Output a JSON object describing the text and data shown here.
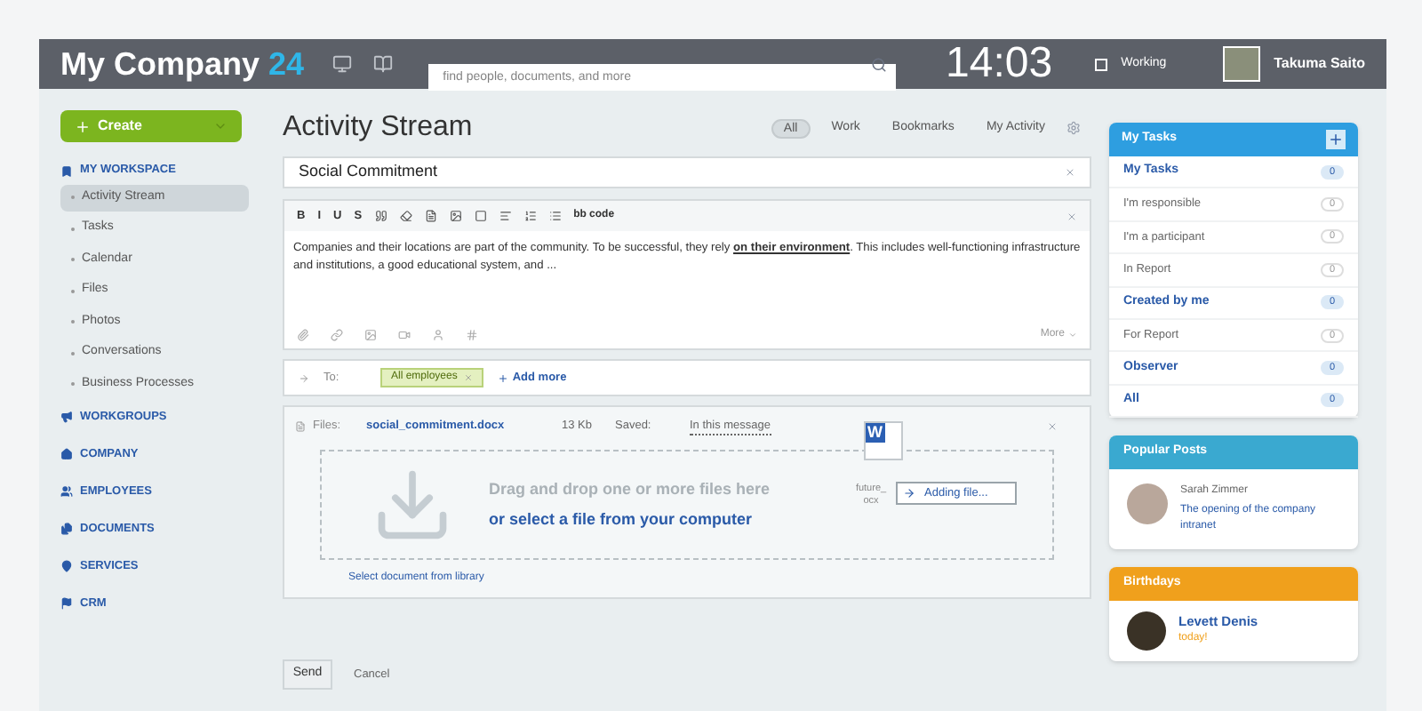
{
  "header": {
    "logo_text": "My Company",
    "logo_number": "24",
    "search": {
      "placeholder": "find people, documents, and more"
    },
    "clock": "14:03",
    "status": {
      "label": "Working",
      "checked": false
    },
    "user": {
      "name": "Takuma Saito"
    }
  },
  "sidebar": {
    "create_button": "Create",
    "sections": [
      {
        "label": "MY WORKSPACE",
        "children": [
          {
            "label": "Activity Stream",
            "selected": true
          },
          {
            "label": "Tasks",
            "selected": false
          },
          {
            "label": "Calendar",
            "selected": false
          },
          {
            "label": "Files",
            "selected": false
          },
          {
            "label": "Photos",
            "selected": false
          },
          {
            "label": "Conversations",
            "selected": false
          },
          {
            "label": "Business Processes",
            "selected": false
          }
        ]
      },
      {
        "label": "WORKGROUPS"
      },
      {
        "label": "COMPANY"
      },
      {
        "label": "EMPLOYEES"
      },
      {
        "label": "DOCUMENTS"
      },
      {
        "label": "SERVICES"
      },
      {
        "label": "CRM"
      }
    ]
  },
  "main": {
    "title": "Activity Stream",
    "filters": [
      {
        "label": "All",
        "selected": true
      },
      {
        "label": "Work",
        "selected": false
      },
      {
        "label": "Bookmarks",
        "selected": false
      },
      {
        "label": "My Activity",
        "selected": false
      }
    ],
    "post": {
      "subject": "Social Commitment",
      "format_buttons": [
        "B",
        "I",
        "U",
        "S"
      ],
      "bbcode_label": "bb code",
      "body": "Companies and their locations are part of the community. To be successful, they rely **on their environment**. This includes well-functioning infrastructure and institutions, a good educational system, and ...",
      "more_label": "More",
      "to_label": "To:",
      "recipients": [
        {
          "label": "All employees"
        }
      ],
      "add_more": "Add more",
      "files": {
        "label": "Files:",
        "name": "social_commitment.docx",
        "size": "13 Kb",
        "saved_label": "Saved:",
        "saved_value": "In this message",
        "drop_text": "Drag and drop one or more files here",
        "select_link": "or select a file from your computer",
        "library_link": "Select document from library",
        "drag_letter": "W",
        "drag_name_top": "future_",
        "drag_name_bottom": "ocx",
        "adding": "Adding file..."
      },
      "send": "Send",
      "cancel": "Cancel"
    }
  },
  "tasks": {
    "title": "My Tasks",
    "rows": [
      {
        "label": "My Tasks",
        "kind": "group",
        "count": "0"
      },
      {
        "label": "I'm responsible",
        "kind": "sub",
        "count": "0"
      },
      {
        "label": "I'm a participant",
        "kind": "sub",
        "count": "0"
      },
      {
        "label": "In Report",
        "kind": "sub",
        "count": "0"
      },
      {
        "label": "Created by me",
        "kind": "group",
        "count": "0"
      },
      {
        "label": "For Report",
        "kind": "sub",
        "count": "0"
      },
      {
        "label": "Observer",
        "kind": "group",
        "count": "0"
      },
      {
        "label": "All",
        "kind": "group",
        "count": "0"
      }
    ]
  },
  "popular": {
    "title": "Popular Posts",
    "author": "Sarah Zimmer",
    "post": "The opening of the company intranet"
  },
  "birthdays": {
    "title": "Birthdays",
    "name": "Levett Denis",
    "when": "today!"
  }
}
